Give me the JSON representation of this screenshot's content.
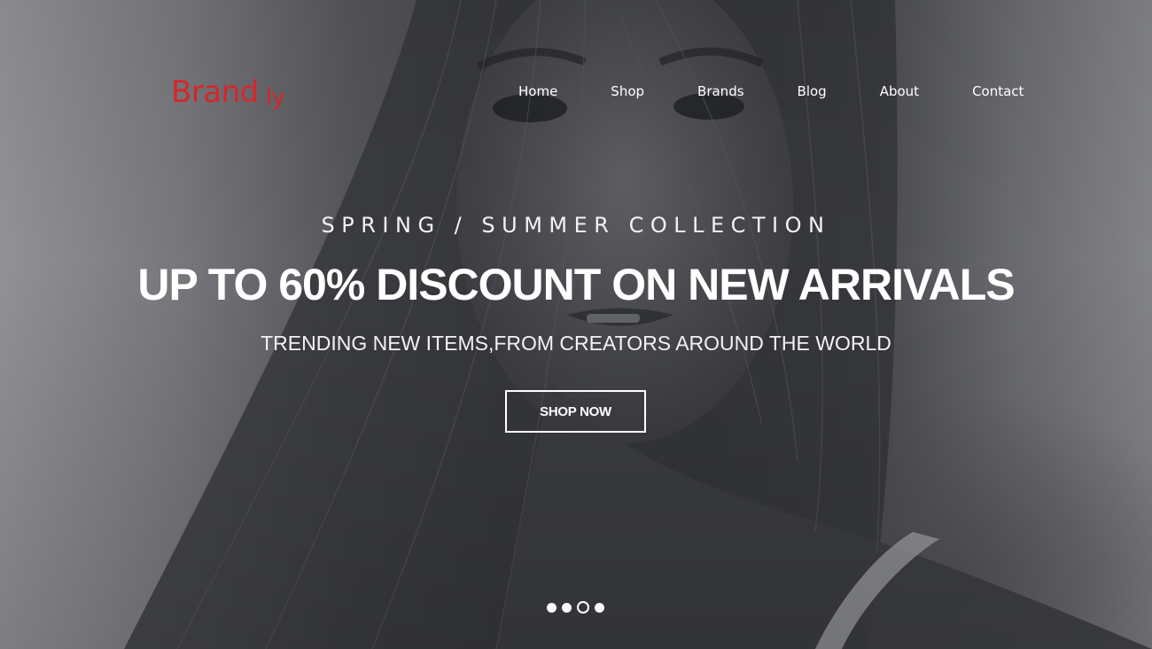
{
  "brand": {
    "name": "Brand",
    "suffix": "ly",
    "color": "#d6262b"
  },
  "nav": {
    "items": [
      {
        "label": "Home"
      },
      {
        "label": "Shop"
      },
      {
        "label": "Brands"
      },
      {
        "label": "Blog"
      },
      {
        "label": "About"
      },
      {
        "label": "Contact"
      }
    ]
  },
  "hero": {
    "eyebrow": "SPRING / SUMMER COLLECTION",
    "headline": "UP TO 60% DISCOUNT ON NEW ARRIVALS",
    "subheadline": "TRENDING NEW ITEMS,FROM CREATORS AROUND THE WORLD",
    "cta_label": "SHOP NOW"
  },
  "slider": {
    "total": 4,
    "active_index": 2
  }
}
